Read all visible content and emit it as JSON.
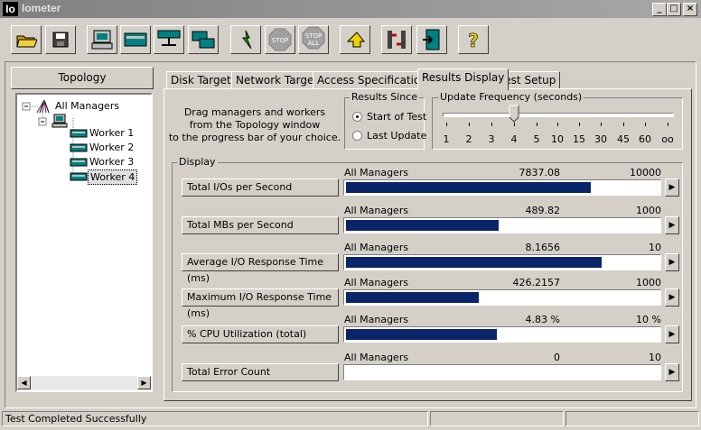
{
  "window": {
    "app_icon_text": "Io",
    "title": "Iometer"
  },
  "toolbar": {
    "buttons": [
      "open-icon",
      "save-icon",
      "start-manager-icon",
      "new-worker-icon",
      "new-network-worker-icon",
      "copy-worker-icon",
      "start-tests-icon",
      "stop-icon",
      "stop-all-icon",
      "reset-workers-icon",
      "disconnect-icon",
      "exit-icon",
      "help-icon"
    ]
  },
  "topology": {
    "header": "Topology",
    "root": "All Managers",
    "workers": [
      "Worker 1",
      "Worker 2",
      "Worker 3",
      "Worker 4"
    ],
    "selected": "Worker 4"
  },
  "tabs": [
    "Disk Targets",
    "Network Targets",
    "Access Specifications",
    "Results Display",
    "Test Setup"
  ],
  "active_tab": "Results Display",
  "results": {
    "drag_instructions": "Drag managers and workers\nfrom the Topology window\nto the progress bar of your choice.",
    "since_title": "Results Since",
    "since_options": [
      "Start of Test",
      "Last Update"
    ],
    "since_selected": "Start of Test",
    "freq_title": "Update Frequency (seconds)",
    "freq_ticks": [
      "1",
      "2",
      "3",
      "4",
      "5",
      "10",
      "15",
      "30",
      "45",
      "60",
      "oo"
    ],
    "freq_value": "4",
    "display_title": "Display"
  },
  "metrics": [
    {
      "name": "Total I/Os per Second",
      "source": "All Managers",
      "value": "7837.08",
      "max": "10000",
      "fraction": 0.7837
    },
    {
      "name": "Total MBs per Second",
      "source": "All Managers",
      "value": "489.82",
      "max": "1000",
      "fraction": 0.4898
    },
    {
      "name": "Average I/O Response Time (ms)",
      "source": "All Managers",
      "value": "8.1656",
      "max": "10",
      "fraction": 0.8166
    },
    {
      "name": "Maximum I/O Response Time (ms)",
      "source": "All Managers",
      "value": "426.2157",
      "max": "1000",
      "fraction": 0.4262
    },
    {
      "name": "% CPU Utilization (total)",
      "source": "All Managers",
      "value": "4.83 %",
      "max": "10 %",
      "fraction": 0.483
    },
    {
      "name": "Total Error Count",
      "source": "All Managers",
      "value": "0",
      "max": "10",
      "fraction": 0
    }
  ],
  "status": {
    "message": "Test Completed Successfully"
  },
  "colors": {
    "bar": "#0a246a",
    "face": "#d4d0c8",
    "selection": "#0a246a"
  }
}
